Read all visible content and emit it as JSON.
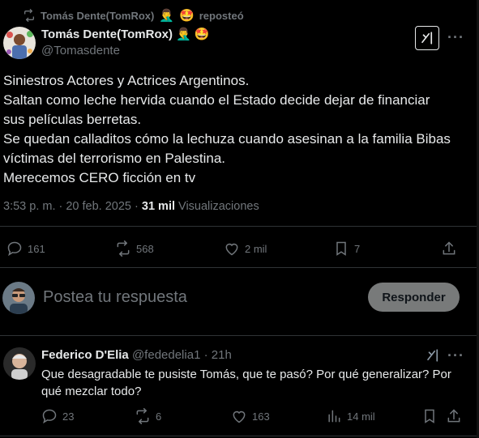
{
  "repost": {
    "text": "Tomás Dente(TomRox)",
    "suffix": "reposteó"
  },
  "post": {
    "author_name": "Tomás Dente(TomRox)",
    "author_handle": "@Tomasdente",
    "lines": [
      "Siniestros Actores y Actrices Argentinos.",
      "Saltan como leche hervida cuando el Estado decide dejar de financiar",
      "sus películas berretas.",
      "Se quedan calladitos cómo la lechuza cuando asesinan a la familia Bibas",
      "víctimas del terrorismo en Palestina.",
      "Merecemos CERO ficción en tv"
    ],
    "time": "3:53 p. m. · 20 feb. 2025 · ",
    "views_count": "31 mil",
    "views_label": "Visualizaciones",
    "replies": "161",
    "reposts": "568",
    "likes": "2 mil",
    "bookmarks": "7"
  },
  "reply_box": {
    "placeholder": "Postea tu respuesta",
    "button": "Responder"
  },
  "comment": {
    "author_name": "Federico D'Elia",
    "author_handle": "@fededelia1",
    "time": "· 21h",
    "lines": [
      "Que desagradable te pusiste Tomás, que te pasó? Por qué generalizar? Por",
      "qué mezclar todo?"
    ],
    "replies": "23",
    "reposts": "6",
    "likes": "163",
    "views": "14 mil"
  },
  "icons": {
    "repost": "repost-icon",
    "reply": "reply-icon",
    "like": "heart-icon",
    "bookmark": "bookmark-icon",
    "share": "share-icon",
    "grok": "grok-icon",
    "views": "views-icon",
    "more": "more-icon"
  },
  "colors": {
    "background": "#000000",
    "text": "#e7e9ea",
    "muted": "#71767b",
    "divider": "#2f3336",
    "button": "#787a7a"
  }
}
